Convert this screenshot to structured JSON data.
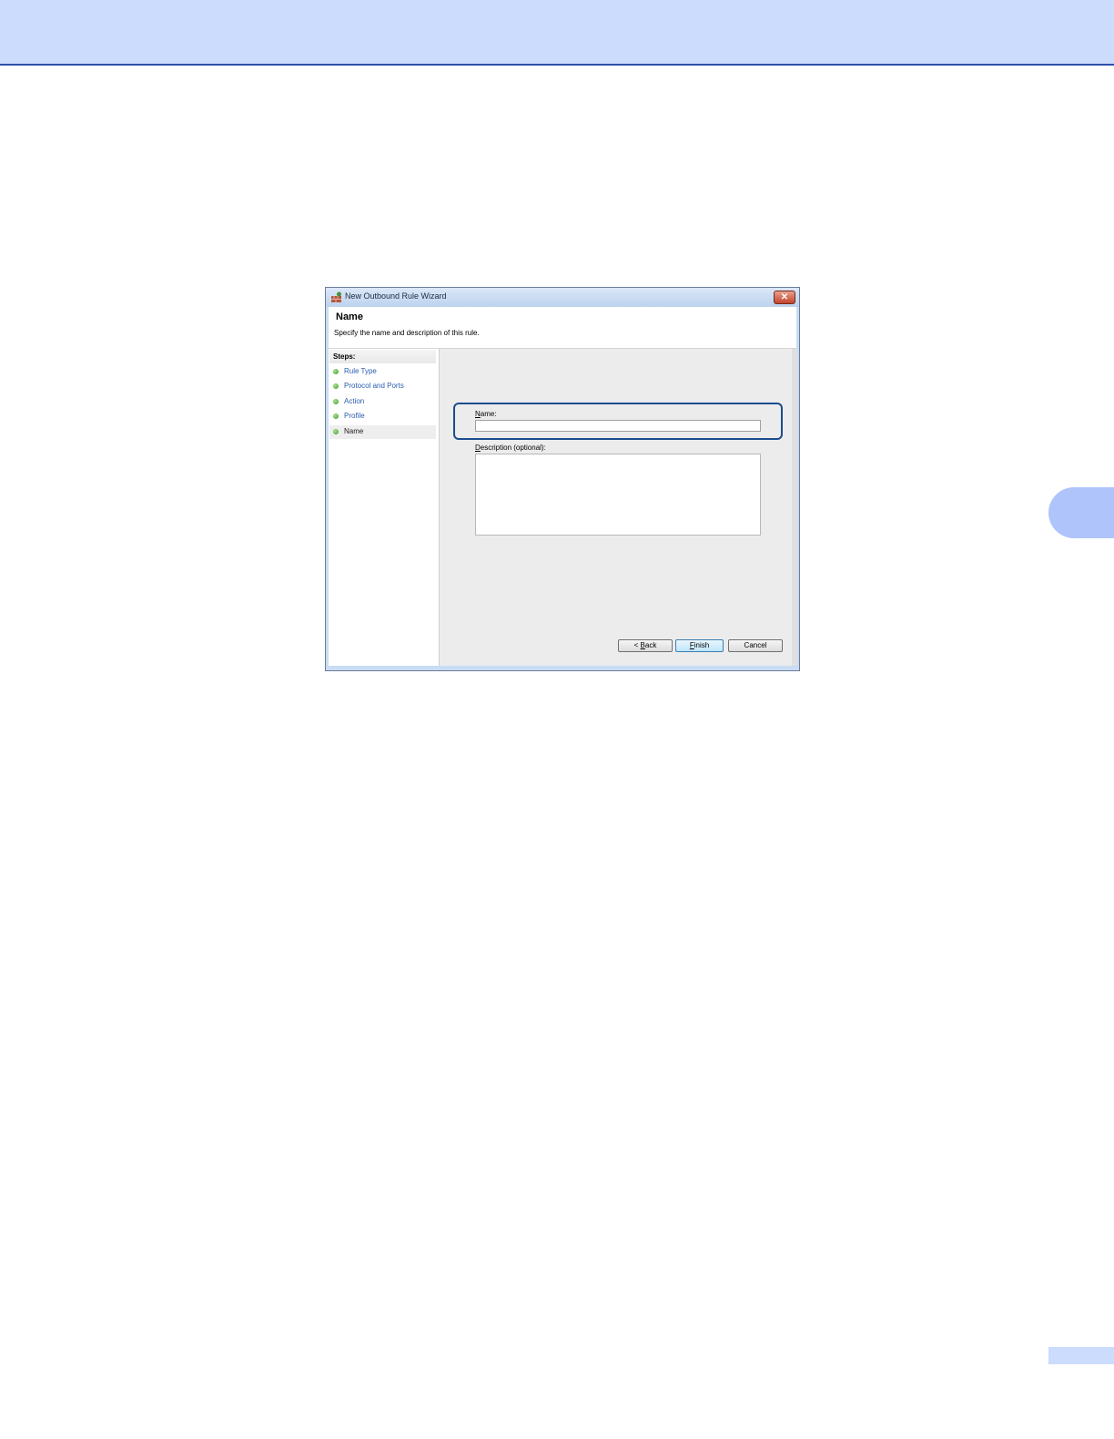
{
  "page": {
    "chapter_marker": "",
    "page_number": ""
  },
  "window": {
    "title": "New Outbound Rule Wizard",
    "close_symbol": "✕"
  },
  "header": {
    "title": "Name",
    "subtitle": "Specify the name and description of this rule."
  },
  "steps": {
    "label": "Steps:",
    "items": [
      {
        "label": "Rule Type"
      },
      {
        "label": "Protocol and Ports"
      },
      {
        "label": "Action"
      },
      {
        "label": "Profile"
      },
      {
        "label": "Name"
      }
    ],
    "current_index": 4
  },
  "form": {
    "name": {
      "label_underlined": "N",
      "label_rest": "ame:",
      "value": ""
    },
    "description": {
      "label_underlined": "D",
      "label_rest": "escription (optional):",
      "value": ""
    }
  },
  "buttons": {
    "back": {
      "prefix": "< ",
      "underlined": "B",
      "rest": "ack"
    },
    "finish": {
      "underlined": "F",
      "rest": "inish"
    },
    "cancel": {
      "label": "Cancel"
    }
  },
  "colors": {
    "top_band": "#ccdcfd",
    "accent": "#1b4d8f",
    "step_dot": "#3b9c2a",
    "step_link": "#2a5db0"
  }
}
